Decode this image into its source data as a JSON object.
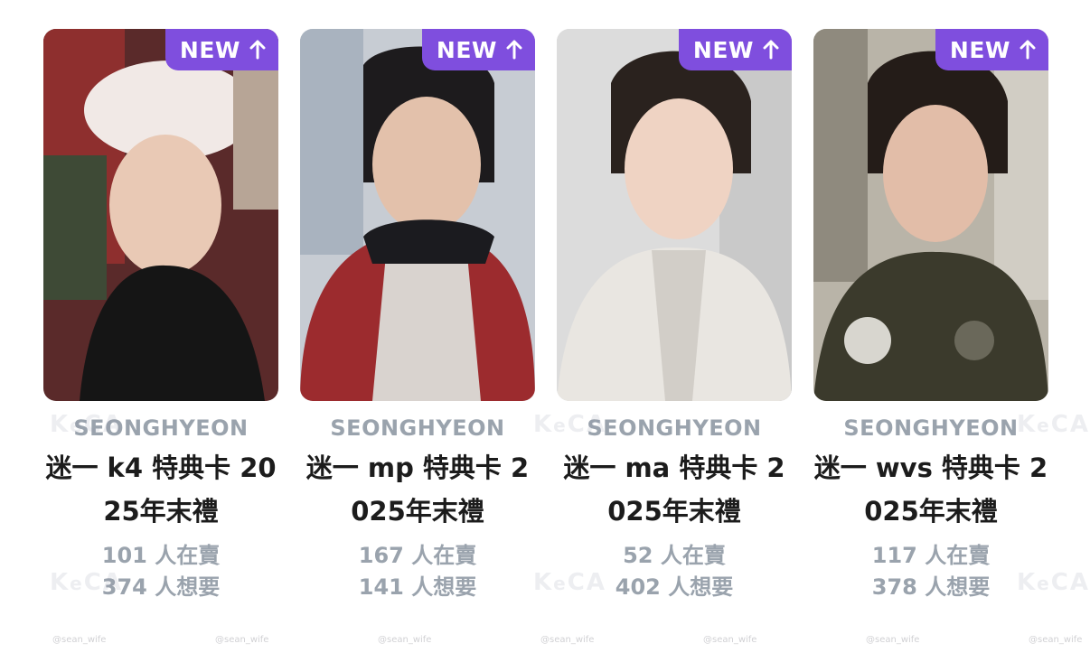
{
  "badge_label": "NEW",
  "accent_color": "#7f4ede",
  "badge_icon": "arrow-up-icon",
  "watermark_handle": "@sean_wife",
  "cards": [
    {
      "artist": "SEONGHYEON",
      "title": "迷一 k4 特典卡 2025年末禮",
      "selling": "101 人在賣",
      "wanting": "374 人想要"
    },
    {
      "artist": "SEONGHYEON",
      "title": "迷一 mp 特典卡 2025年末禮",
      "selling": "167 人在賣",
      "wanting": "141 人想要"
    },
    {
      "artist": "SEONGHYEON",
      "title": "迷一 ma 特典卡 2025年末禮",
      "selling": "52 人在賣",
      "wanting": "402 人想要"
    },
    {
      "artist": "SEONGHYEON",
      "title": "迷一 wvs 特典卡 2025年末禮",
      "selling": "117 人在賣",
      "wanting": "378 人想要"
    }
  ]
}
